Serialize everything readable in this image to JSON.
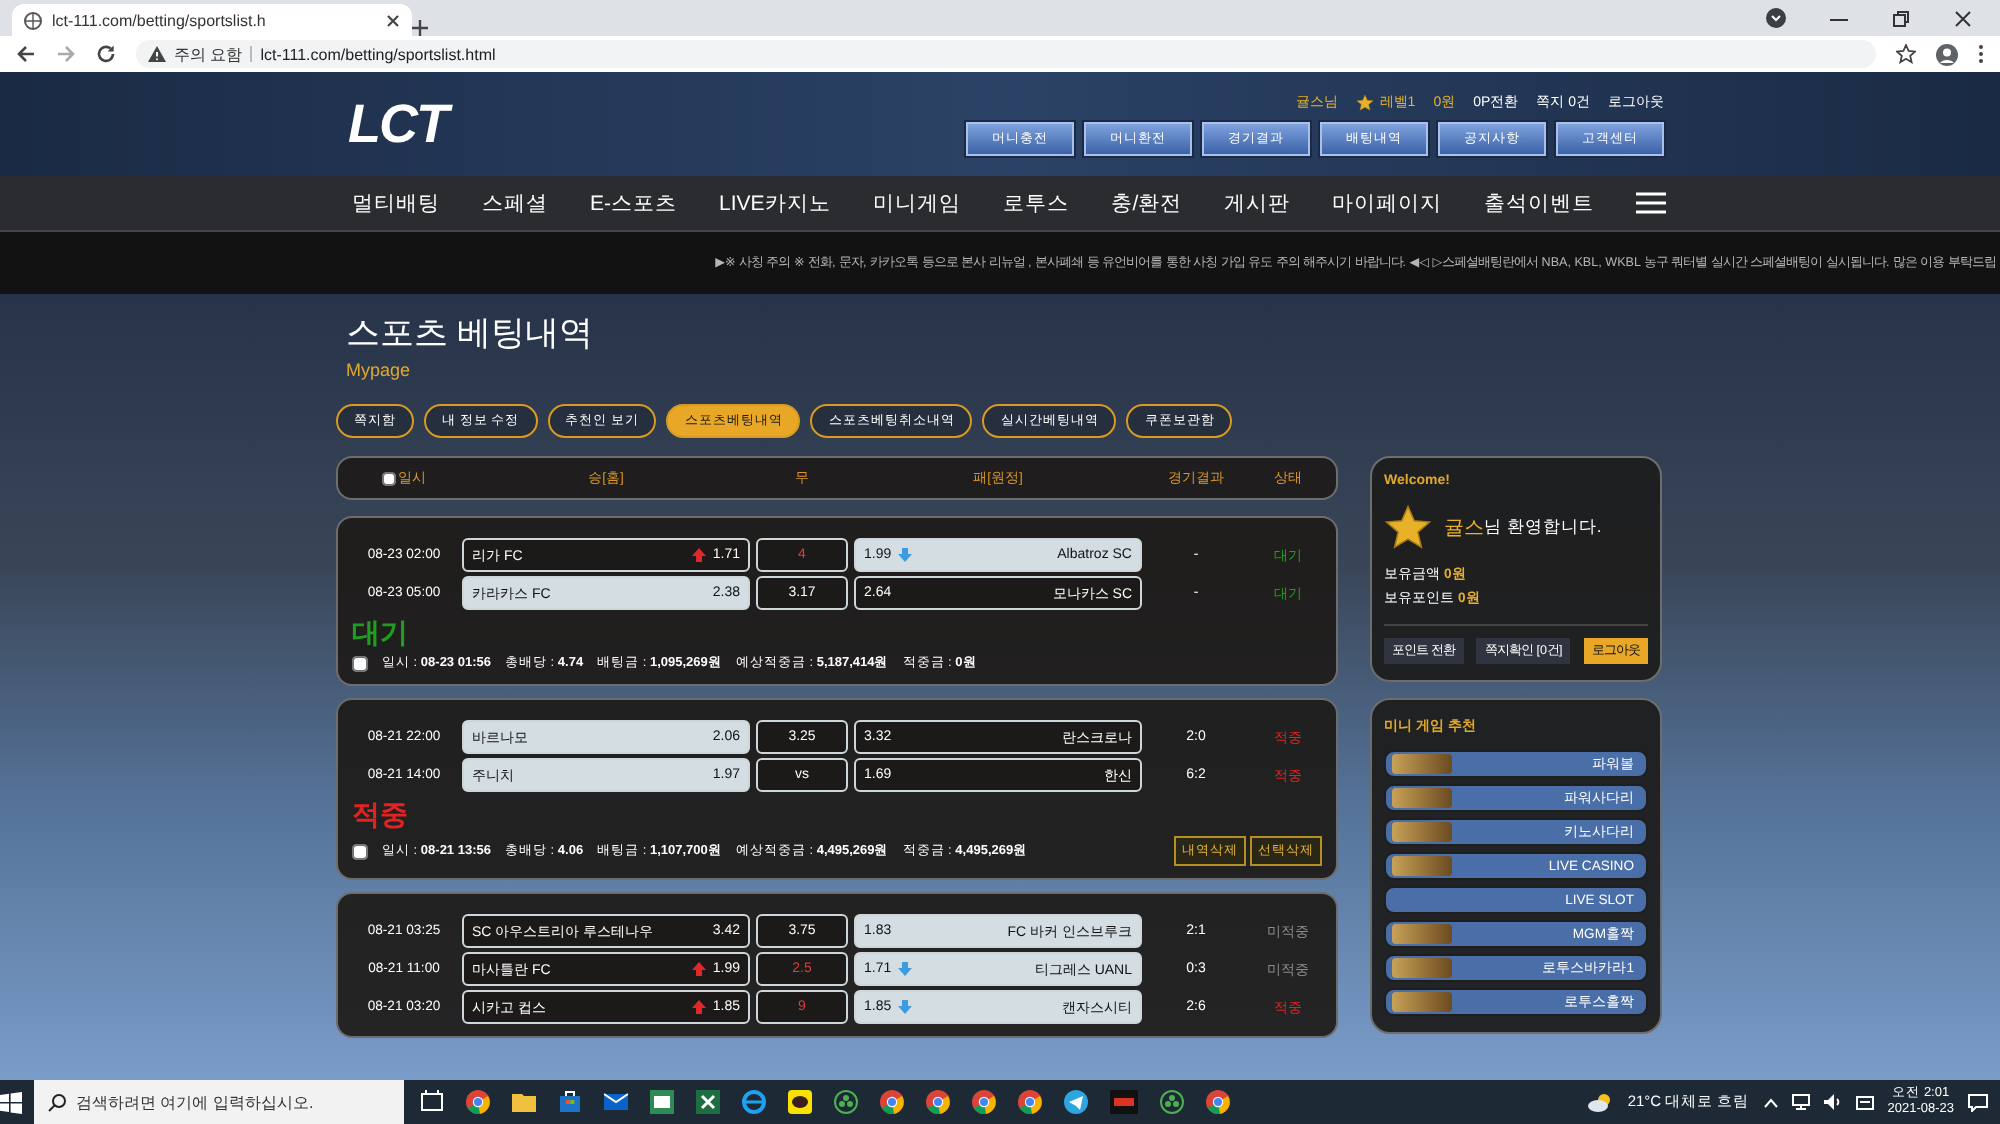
{
  "browser": {
    "tab_title": "lct-111.com/betting/sportslist.h",
    "warning": "주의 요함",
    "url": "lct-111.com/betting/sportslist.html"
  },
  "header": {
    "logo": "LCT",
    "user_bar": [
      {
        "text": "귤스님",
        "accent": true,
        "kind": "text"
      },
      {
        "text": "레벨1",
        "accent": true,
        "kind": "level"
      },
      {
        "text": "0원",
        "accent": true,
        "kind": "text"
      },
      {
        "text": "0P전환",
        "accent": false,
        "kind": "text"
      },
      {
        "text": "쪽지 0건",
        "accent": false,
        "kind": "text"
      },
      {
        "text": "로그아웃",
        "accent": false,
        "kind": "text"
      }
    ],
    "buttons": [
      "머니충전",
      "머니환전",
      "경기결과",
      "배팅내역",
      "공지사항",
      "고객센터"
    ],
    "nav": [
      "멀티배팅",
      "스페셜",
      "E-스포츠",
      "LIVE카지노",
      "미니게임",
      "로투스",
      "충/환전",
      "게시판",
      "마이페이지",
      "출석이벤트"
    ],
    "ticker": "▶※ 사칭 주의 ※ 전화, 문자, 카카오톡 등으로 본사 리뉴얼 , 본사폐쇄 등 유언비어를 통한 사칭 가입 유도 주의 해주시기 바랍니다. ◀◁ ▷스페셜배팅란에서 NBA, KBL, WKBL 농구 쿼터별 실시간 스페셜배팅이 실시됩니다. 많은 이용 부탁드립"
  },
  "page": {
    "title": "스포츠 베팅내역",
    "subtitle": "Mypage"
  },
  "tabs": [
    {
      "label": "쪽지함",
      "selected": false
    },
    {
      "label": "내 정보 수정",
      "selected": false
    },
    {
      "label": "추천인 보기",
      "selected": false
    },
    {
      "label": "스포츠베팅내역",
      "selected": true
    },
    {
      "label": "스포츠베팅취소내역",
      "selected": false
    },
    {
      "label": "실시간베팅내역",
      "selected": false
    },
    {
      "label": "쿠폰보관함",
      "selected": false
    }
  ],
  "table": {
    "select_all": {
      "checked": false
    },
    "columns": [
      "일시",
      "승[홈]",
      "무",
      "패[원정]",
      "경기결과",
      "상태"
    ]
  },
  "bets": [
    {
      "rows": [
        {
          "time": "08-23 02:00",
          "home": "리가 FC",
          "home_odds": "1.71",
          "draw": "4",
          "away_odds": "1.99",
          "away": "Albatroz SC",
          "result": "-",
          "status": "대기",
          "kind": "pending",
          "home_selected": false,
          "draw_selected": false,
          "away_selected": true,
          "odds_changed": true
        },
        {
          "time": "08-23 05:00",
          "home": "카라카스 FC",
          "home_odds": "2.38",
          "draw": "3.17",
          "away_odds": "2.64",
          "away": "모나카스 SC",
          "result": "-",
          "status": "대기",
          "kind": "pending",
          "home_selected": true,
          "draw_selected": false,
          "away_selected": false,
          "odds_changed": false
        }
      ],
      "status": "대기",
      "kind": "pending",
      "summary": {
        "checked": false,
        "items": [
          "일시 : **08-23 01:56**",
          "총배당 : **4.74**",
          "배팅금 : **1,095,269원**",
          "예상적중금 : **5,187,414원**",
          "적중금 : **0원**"
        ]
      }
    },
    {
      "rows": [
        {
          "time": "08-21 22:00",
          "home": "바르나모",
          "home_odds": "2.06",
          "draw": "3.25",
          "away_odds": "3.32",
          "away": "란스크로나",
          "result": "2:0",
          "status": "적중",
          "kind": "win",
          "home_selected": true,
          "draw_selected": false,
          "away_selected": false,
          "odds_changed": false
        },
        {
          "time": "08-21 14:00",
          "home": "주니치",
          "home_odds": "1.97",
          "draw": "vs",
          "away_odds": "1.69",
          "away": "한신",
          "result": "6:2",
          "status": "적중",
          "kind": "win",
          "home_selected": true,
          "draw_selected": false,
          "away_selected": false,
          "odds_changed": false
        }
      ],
      "status": "적중",
      "kind": "win",
      "summary": {
        "checked": false,
        "items": [
          "일시 : **08-21 13:56**",
          "총배당 : **4.06**",
          "배팅금 : **1,107,700원**",
          "예상적중금 : **4,495,269원**",
          "적중금 : **4,495,269원**"
        ]
      },
      "buttons": [
        "내역삭제",
        "선택삭제"
      ]
    },
    {
      "rows": [
        {
          "time": "08-21 03:25",
          "home": "SC 아우스트리아 루스테나우",
          "home_odds": "3.42",
          "draw": "3.75",
          "away_odds": "1.83",
          "away": "FC 바커 인스브루크",
          "result": "2:1",
          "status": "미적중",
          "kind": "lose",
          "home_selected": false,
          "draw_selected": false,
          "away_selected": true,
          "odds_changed": false
        },
        {
          "time": "08-21 11:00",
          "home": "마사틀란 FC",
          "home_odds": "1.99",
          "draw": "2.5",
          "away_odds": "1.71",
          "away": "티그레스 UANL",
          "result": "0:3",
          "status": "미적중",
          "kind": "lose",
          "home_selected": false,
          "draw_selected": false,
          "away_selected": true,
          "odds_changed": true
        },
        {
          "time": "08-21 03:20",
          "home": "시카고 컵스",
          "home_odds": "1.85",
          "draw": "9",
          "away_odds": "1.85",
          "away": "캔자스시티",
          "result": "2:6",
          "status": "적중",
          "kind": "win",
          "home_selected": false,
          "draw_selected": false,
          "away_selected": true,
          "odds_changed": true
        }
      ]
    }
  ],
  "sidebar": {
    "welcome": {
      "title": "Welcome!",
      "user": "귤스",
      "greeting": "님 환영합니다.",
      "balances": [
        {
          "label": "보유금액",
          "value": "0원"
        },
        {
          "label": "보유포인트",
          "value": "0원"
        }
      ],
      "buttons": [
        {
          "label": "포인트 전환",
          "highlighted": false
        },
        {
          "label": "쪽지확인 [0건]",
          "highlighted": false
        },
        {
          "label": "로그아웃",
          "highlighted": true
        }
      ]
    },
    "games": {
      "title": "미니 게임 추천",
      "items": [
        {
          "name": "파워볼",
          "logo": true
        },
        {
          "name": "파워사다리",
          "logo": true
        },
        {
          "name": "키노사다리",
          "logo": true
        },
        {
          "name": "LIVE CASINO",
          "logo": true
        },
        {
          "name": "LIVE SLOT",
          "logo": false
        },
        {
          "name": "MGM홀짝",
          "logo": true
        },
        {
          "name": "로투스바카라1",
          "logo": true
        },
        {
          "name": "로투스홀짝",
          "logo": true
        }
      ]
    }
  },
  "taskbar": {
    "search_placeholder": "검색하려면 여기에 입력하십시오.",
    "weather": "21°C 대체로 흐림",
    "time": "오전 2:01",
    "date": "2021-08-23"
  }
}
